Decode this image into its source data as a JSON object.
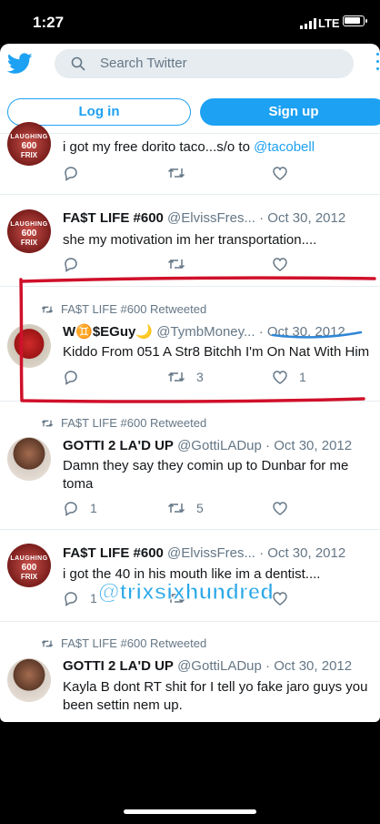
{
  "status": {
    "time": "1:27",
    "network": "LTE"
  },
  "search": {
    "placeholder": "Search Twitter"
  },
  "auth": {
    "login_label": "Log in",
    "signup_label": "Sign up"
  },
  "tweets": [
    {
      "text": "i got my free dorito taco...s/o to ",
      "mention": "@tacobell",
      "reply": "",
      "retweet": "",
      "like": ""
    },
    {
      "name": "FA$T LIFE #600",
      "handle": "@ElvissFres...",
      "sep": "·",
      "date": "Oct 30, 2012",
      "text": "she my motivation im her transportation....",
      "reply": "",
      "retweet": "",
      "like": ""
    },
    {
      "rt_by": "FA$T LIFE #600 Retweeted",
      "name": "W♊$EGuy🌙",
      "handle": "@TymbMoney...",
      "sep": "·",
      "date": "Oct 30, 2012",
      "text": "Kiddo From 051 A Str8 Bitchh I'm On Nat With Him",
      "reply": "",
      "retweet": "3",
      "like": "1"
    },
    {
      "rt_by": "FA$T LIFE #600 Retweeted",
      "name": "GOTTI 2 LA'D UP",
      "handle": "@GottiLADup",
      "sep": "·",
      "date": "Oct 30, 2012",
      "text": "Damn they say they comin up to Dunbar for me toma",
      "reply": "1",
      "retweet": "5",
      "like": ""
    },
    {
      "name": "FA$T LIFE #600",
      "handle": "@ElvissFres...",
      "sep": "·",
      "date": "Oct 30, 2012",
      "text": "i got the 40 in his mouth like im a dentist....",
      "reply": "1",
      "retweet": "",
      "like": ""
    },
    {
      "rt_by": "FA$T LIFE #600 Retweeted",
      "name": "GOTTI 2 LA'D UP",
      "handle": "@GottiLADup",
      "sep": "·",
      "date": "Oct 30, 2012",
      "text": "Kayla B dont RT shit for I tell yo fake jaro guys you been settin nem up.",
      "reply": "",
      "retweet": "",
      "like": ""
    }
  ],
  "avatar_text": {
    "line1": "LAUGHING",
    "line2": "600",
    "line3": "FRIX"
  },
  "overlay": {
    "text": "@trixsixhundred"
  },
  "colors": {
    "accent": "#1da1f2",
    "annotation_box": "#d0102a",
    "underline": "#2f86d6"
  }
}
